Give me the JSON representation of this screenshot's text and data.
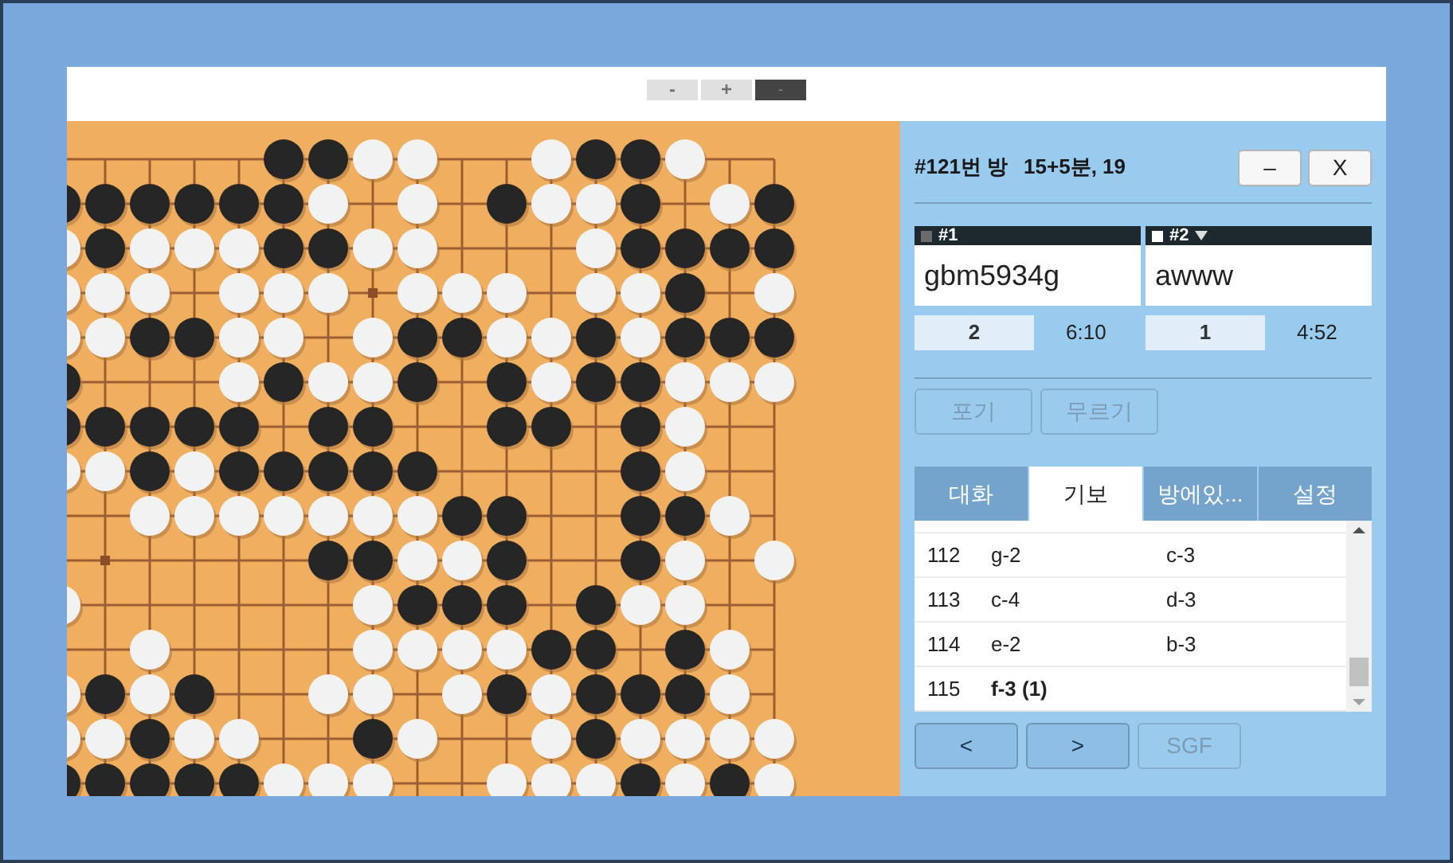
{
  "toolbar": {
    "buttons": [
      {
        "label": "-",
        "selected": false
      },
      {
        "label": "+",
        "selected": false
      },
      {
        "label": "-",
        "selected": true
      }
    ]
  },
  "room": {
    "title": "#121번 방",
    "settings": "15+5분, 19",
    "buttons": [
      "–",
      "X"
    ]
  },
  "players": [
    {
      "label": "#1",
      "kind": "black",
      "turn": false,
      "name": "gbm5934g",
      "captures": "2",
      "time": "6:10"
    },
    {
      "label": "#2",
      "kind": "white",
      "turn": true,
      "name": "awww",
      "captures": "1",
      "time": "4:52"
    }
  ],
  "actions": [
    {
      "label": "포기",
      "disabled": true
    },
    {
      "label": "무르기",
      "disabled": true
    }
  ],
  "tabs": [
    {
      "label": "대화",
      "selected": false
    },
    {
      "label": "기보",
      "selected": true
    },
    {
      "label": "방에있...",
      "selected": false
    },
    {
      "label": "설정",
      "selected": false
    }
  ],
  "moves": [
    {
      "number": "112",
      "black": "g-2",
      "white": "c-3",
      "current": false
    },
    {
      "number": "113",
      "black": "c-4",
      "white": "d-3",
      "current": false
    },
    {
      "number": "114",
      "black": "e-2",
      "white": "b-3",
      "current": false
    },
    {
      "number": "115",
      "black": "f-3 (1)",
      "current": true
    }
  ],
  "nav": [
    {
      "label": "<",
      "disabled": false
    },
    {
      "label": ">",
      "disabled": false
    },
    {
      "label": "SGF",
      "disabled": true
    }
  ]
}
